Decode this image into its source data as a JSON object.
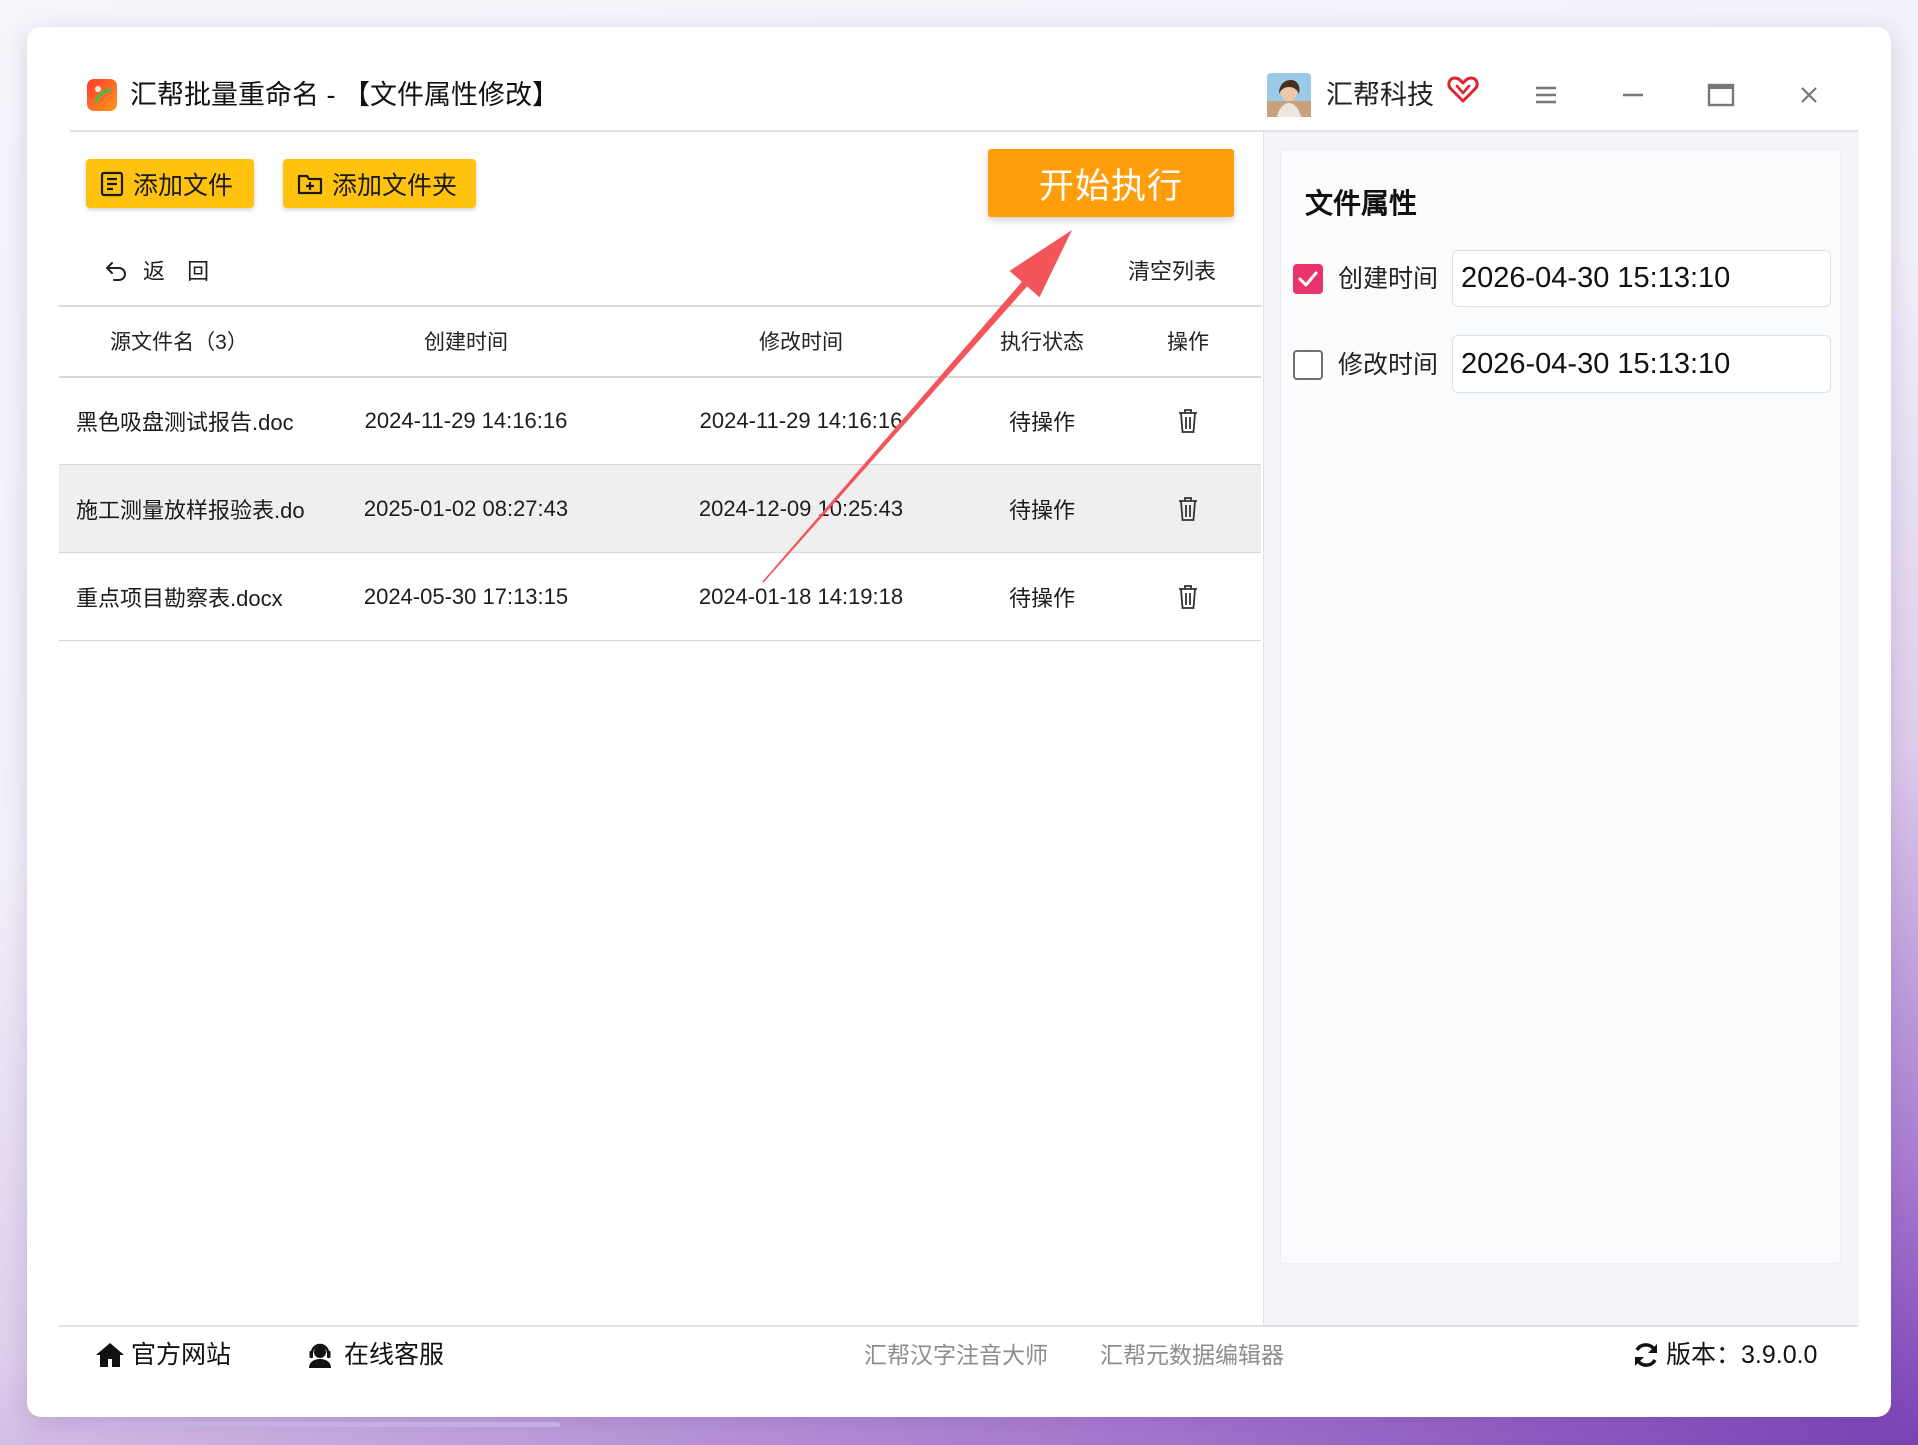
{
  "window": {
    "title": "汇帮批量重命名 - 【文件属性修改】",
    "brand": "汇帮科技",
    "icons": [
      "app-logo-icon",
      "avatar",
      "vip-heart-icon",
      "menu-icon",
      "minimize-icon",
      "maximize-icon",
      "close-icon"
    ]
  },
  "toolbar": {
    "add_file_label": "添加文件",
    "add_file_icon": "document-list-icon",
    "add_folder_label": "添加文件夹",
    "add_folder_icon": "folder-plus-icon",
    "start_label": "开始执行",
    "back_label": "返 回",
    "back_icon": "back-arrow-icon",
    "clear_label": "清空列表"
  },
  "table": {
    "headers": {
      "name": "源文件名（3）",
      "created": "创建时间",
      "modified": "修改时间",
      "status": "执行状态",
      "action": "操作"
    },
    "action_icon": "trash-icon",
    "rows": [
      {
        "name": "黑色吸盘测试报告.doc",
        "created": "2024-11-29 14:16:16",
        "modified": "2024-11-29 14:16:16",
        "status": "待操作"
      },
      {
        "name": "施工测量放样报验表.do",
        "created": "2025-01-02 08:27:43",
        "modified": "2024-12-09 10:25:43",
        "status": "待操作"
      },
      {
        "name": "重点项目勘察表.docx",
        "created": "2024-05-30 17:13:15",
        "modified": "2024-01-18 14:19:18",
        "status": "待操作"
      }
    ]
  },
  "properties": {
    "title": "文件属性",
    "created": {
      "label": "创建时间",
      "checked": true,
      "value": "2026-04-30 15:13:10"
    },
    "modified": {
      "label": "修改时间",
      "checked": false,
      "value": "2026-04-30 15:13:10"
    }
  },
  "footer": {
    "website_label": "官方网站",
    "website_icon": "home-icon",
    "support_label": "在线客服",
    "support_icon": "customer-service-icon",
    "link_phonetic": "汇帮汉字注音大师",
    "link_metadata": "汇帮元数据编辑器",
    "version_icon": "refresh-icon",
    "version": "版本：3.9.0.0"
  },
  "colors": {
    "accent_yellow": "#FFC20E",
    "start_orange": "#FF9E0A",
    "checkbox_active": "#E8336D",
    "annotation_arrow": "#F4555B"
  }
}
